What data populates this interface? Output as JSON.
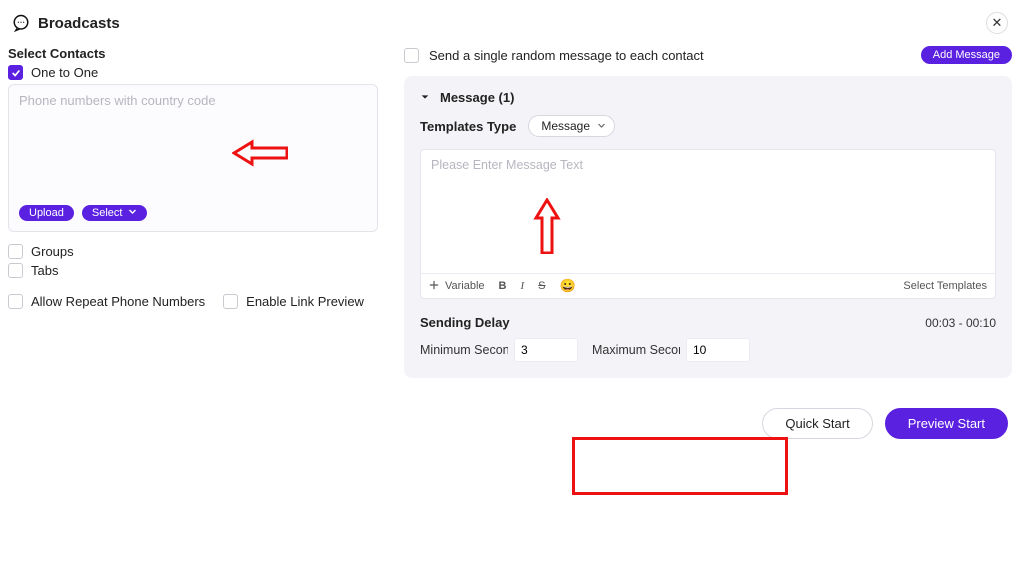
{
  "header": {
    "title": "Broadcasts"
  },
  "left": {
    "select_contacts": "Select Contacts",
    "one_to_one": "One to One",
    "phone_placeholder": "Phone numbers with country code",
    "upload": "Upload",
    "select": "Select",
    "groups": "Groups",
    "tabs": "Tabs",
    "allow_repeat": "Allow Repeat Phone Numbers",
    "enable_link": "Enable Link Preview"
  },
  "right": {
    "random_label": "Send a single random message to each contact",
    "add_message": "Add Message",
    "message_header": "Message (1)",
    "templates_type_label": "Templates Type",
    "templates_type_value": "Message",
    "msg_placeholder": "Please Enter Message Text",
    "toolbar": {
      "variable": "Variable",
      "b": "B",
      "i": "I",
      "s": "S",
      "select_templates": "Select Templates"
    },
    "sending_delay": "Sending Delay",
    "delay_range": "00:03 - 00:10",
    "min_label": "Minimum Seconds",
    "max_label": "Maximum Seconds",
    "min_value": "3",
    "max_value": "10"
  },
  "footer": {
    "quick_start": "Quick Start",
    "preview_start": "Preview Start"
  }
}
